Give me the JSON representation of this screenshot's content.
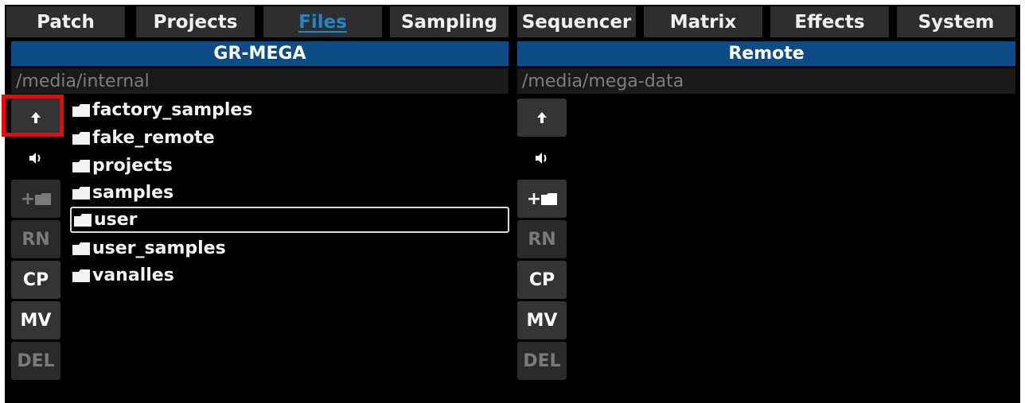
{
  "tabs": [
    {
      "label": "Patch",
      "active": false
    },
    {
      "label": "Projects",
      "active": false
    },
    {
      "label": "Files",
      "active": true
    },
    {
      "label": "Sampling",
      "active": false
    },
    {
      "label": "Sequencer",
      "active": false
    },
    {
      "label": "Matrix",
      "active": false
    },
    {
      "label": "Effects",
      "active": false
    },
    {
      "label": "System",
      "active": false
    }
  ],
  "left_pane": {
    "title": "GR-MEGA",
    "path": "/media/internal",
    "buttons": [
      {
        "icon": "arrow-up-icon",
        "enabled": true,
        "highlighted": true
      },
      {
        "icon": "speaker-icon",
        "enabled": true
      },
      {
        "label": "+",
        "icon": "folder-icon",
        "enabled": false
      },
      {
        "label": "RN",
        "enabled": false
      },
      {
        "label": "CP",
        "enabled": true
      },
      {
        "label": "MV",
        "enabled": true
      },
      {
        "label": "DEL",
        "enabled": false
      }
    ],
    "files": [
      {
        "name": "factory_samples",
        "type": "folder"
      },
      {
        "name": "fake_remote",
        "type": "folder"
      },
      {
        "name": "projects",
        "type": "folder"
      },
      {
        "name": "samples",
        "type": "folder"
      },
      {
        "name": "user",
        "type": "folder",
        "selected": true
      },
      {
        "name": "user_samples",
        "type": "folder"
      },
      {
        "name": "vanalles",
        "type": "folder"
      }
    ]
  },
  "right_pane": {
    "title": "Remote",
    "path": "/media/mega-data",
    "buttons": [
      {
        "icon": "arrow-up-icon",
        "enabled": true
      },
      {
        "icon": "speaker-icon",
        "enabled": true
      },
      {
        "label": "+",
        "icon": "folder-icon",
        "enabled": true
      },
      {
        "label": "RN",
        "enabled": false
      },
      {
        "label": "CP",
        "enabled": true
      },
      {
        "label": "MV",
        "enabled": true
      },
      {
        "label": "DEL",
        "enabled": false
      }
    ],
    "files": []
  },
  "colors": {
    "accent": "#1e87c8",
    "header_bg": "#0d4c86",
    "highlight": "#ff0000"
  }
}
